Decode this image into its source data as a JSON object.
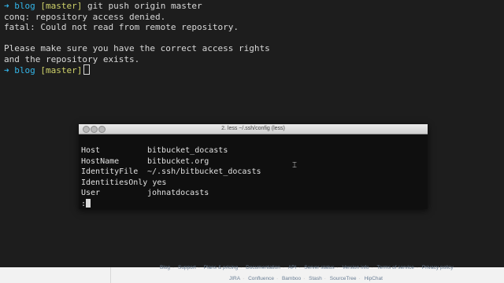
{
  "terminal": {
    "lines": [
      {
        "type": "prompt",
        "arrow": "➜",
        "dir": "blog",
        "branch": "[master]",
        "command": "git push origin master"
      },
      {
        "type": "output",
        "text": "conq: repository access denied."
      },
      {
        "type": "output",
        "text": "fatal: Could not read from remote repository."
      },
      {
        "type": "output",
        "text": ""
      },
      {
        "type": "output",
        "text": "Please make sure you have the correct access rights"
      },
      {
        "type": "output",
        "text": "and the repository exists."
      },
      {
        "type": "prompt",
        "arrow": "➜",
        "dir": "blog",
        "branch": "[master]",
        "command": ""
      }
    ]
  },
  "less_window": {
    "title": "2. less ~/.ssh/config (less)",
    "config": [
      {
        "key": "Host",
        "value": "bitbucket_docasts"
      },
      {
        "key": "HostName",
        "value": "bitbucket.org"
      },
      {
        "key": "IdentityFile",
        "value": "~/.ssh/bitbucket_docasts"
      },
      {
        "key": "IdentitiesOnly",
        "value": "yes"
      },
      {
        "key": "User",
        "value": "johnatdocasts"
      }
    ],
    "pager_prompt": ":"
  },
  "footer": {
    "row1": [
      "Blog",
      "Support",
      "Plans & pricing",
      "Documentation",
      "API",
      "Server status",
      "Version info",
      "Terms of service",
      "Privacy policy"
    ],
    "row2": [
      "JIRA",
      "Confluence",
      "Bamboo",
      "Stash",
      "SourceTree",
      "HipChat"
    ]
  },
  "colors": {
    "terminal_bg": "#1d1d1d",
    "prompt_arrow": "#31b0e6",
    "prompt_branch": "#cfd26a",
    "text": "#d8d8d8",
    "footer_link": "#6a7e95"
  }
}
